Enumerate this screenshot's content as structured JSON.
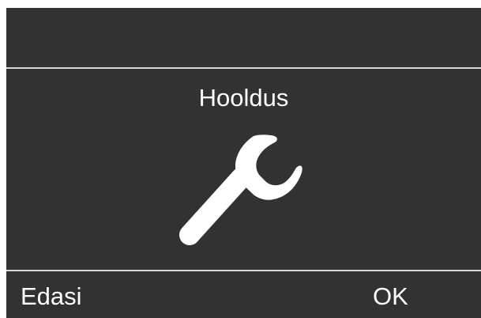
{
  "screen": {
    "title": "Hooldus",
    "icon": "wrench-icon",
    "background_color": "#323232",
    "text_color": "#ffffff",
    "divider_color": "#d9d9d9"
  },
  "softkeys": {
    "left_label": "Edasi",
    "right_label": "OK"
  }
}
